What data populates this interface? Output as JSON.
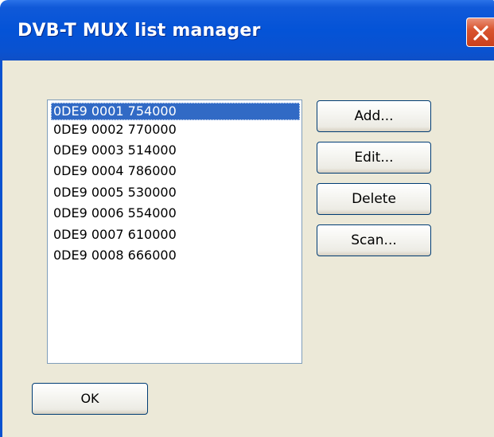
{
  "window": {
    "title": "DVB-T MUX list manager"
  },
  "mux_list": {
    "items": [
      "0DE9 0001 754000",
      "0DE9 0002 770000",
      "0DE9 0003 514000",
      "0DE9 0004 786000",
      "0DE9 0005 530000",
      "0DE9 0006 554000",
      "0DE9 0007 610000",
      "0DE9 0008 666000"
    ],
    "selected_index": 0
  },
  "buttons": {
    "add": "Add...",
    "edit": "Edit...",
    "delete": "Delete",
    "scan": "Scan...",
    "ok": "OK"
  },
  "colors": {
    "titlebar": "#0453d7",
    "selection": "#316ac5",
    "client_background": "#ece9d8",
    "close_button": "#d9552f"
  },
  "icons": {
    "close": "close-icon"
  }
}
